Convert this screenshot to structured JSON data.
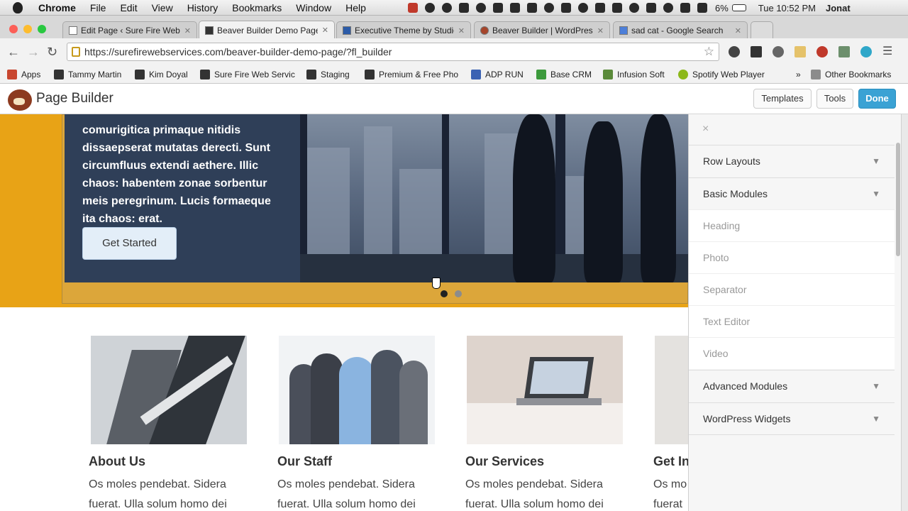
{
  "macmenu": {
    "app": "Chrome",
    "items": [
      "File",
      "Edit",
      "View",
      "History",
      "Bookmarks",
      "Window",
      "Help"
    ],
    "battery": "6%",
    "clock": "Tue 10:52 PM",
    "user": "Jonat"
  },
  "tabs": [
    {
      "title": "Edit Page ‹ Sure Fire Web S"
    },
    {
      "title": "Beaver Builder Demo Page"
    },
    {
      "title": "Executive Theme by Studio"
    },
    {
      "title": "Beaver Builder | WordPress"
    },
    {
      "title": "sad cat - Google Search"
    }
  ],
  "address": {
    "url": "https://surefirewebservices.com/beaver-builder-demo-page/?fl_builder"
  },
  "bookmarks": [
    {
      "label": "Apps"
    },
    {
      "label": "Tammy Martin"
    },
    {
      "label": "Kim Doyal"
    },
    {
      "label": "Sure Fire Web Servic"
    },
    {
      "label": "Staging"
    },
    {
      "label": "Premium & Free Pho"
    },
    {
      "label": "ADP RUN"
    },
    {
      "label": "Base CRM"
    },
    {
      "label": "Infusion Soft"
    },
    {
      "label": "Spotify Web Player"
    },
    {
      "label": "»"
    },
    {
      "label": "Other Bookmarks"
    }
  ],
  "builder": {
    "title": "Page Builder",
    "templates": "Templates",
    "tools": "Tools",
    "done": "Done"
  },
  "hero": {
    "text": "comurigitica primaque nitidis\ndissaepserat mutatas derecti. Sunt\ncircumfluus extendi aethere. Illic\nchaos: habentem zonae sorbentur\nmeis peregrinum. Lucis formaeque\nita chaos: erat.",
    "button": "Get Started"
  },
  "columns": [
    {
      "title": "About Us",
      "line1": "Os moles pendebat. Sidera",
      "line2": "fuerat. Ulla solum homo dei"
    },
    {
      "title": "Our Staff",
      "line1": "Os moles pendebat. Sidera",
      "line2": "fuerat. Ulla solum homo dei"
    },
    {
      "title": "Our Services",
      "line1": "Os moles pendebat. Sidera",
      "line2": "fuerat. Ulla solum homo dei"
    },
    {
      "title": "Get In",
      "line1": "Os mo",
      "line2": "fuerat"
    }
  ],
  "panel": {
    "close": "×",
    "sections": [
      {
        "label": "Row Layouts"
      },
      {
        "label": "Basic Modules"
      },
      {
        "label": "Advanced Modules"
      },
      {
        "label": "WordPress Widgets"
      }
    ],
    "modules": [
      "Heading",
      "Photo",
      "Separator",
      "Text Editor",
      "Video"
    ]
  },
  "colors": {
    "accent": "#3aa2d4",
    "hero_bg": "#e8a316",
    "hero_band": "#dca63a"
  }
}
